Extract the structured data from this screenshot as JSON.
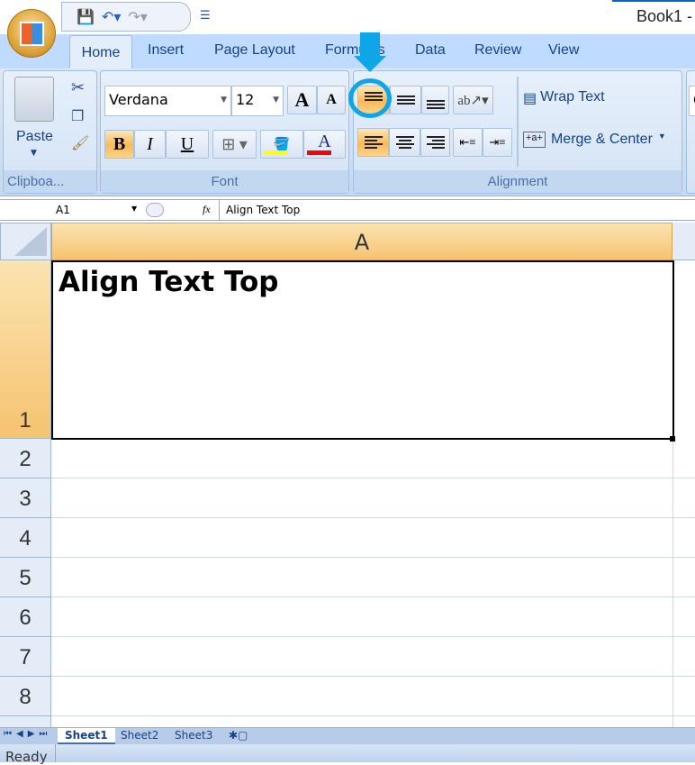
{
  "window": {
    "title": "Book1 -"
  },
  "quick_access": {
    "save_icon": "save-icon",
    "undo_icon": "undo-icon",
    "redo_icon": "redo-icon",
    "customize": "▼"
  },
  "tabs": [
    "Home",
    "Insert",
    "Page Layout",
    "Formulas",
    "Data",
    "Review",
    "View"
  ],
  "ribbon": {
    "clipboard": {
      "label": "Clipboa...",
      "paste": "Paste"
    },
    "font": {
      "label": "Font",
      "font_name": "Verdana",
      "font_size": "12",
      "bold": "B",
      "italic": "I",
      "underline": "U",
      "grow": "A",
      "shrink": "A",
      "font_color": "A",
      "fill_color_hex": "#ffff00",
      "font_color_hex": "#ff0000"
    },
    "alignment": {
      "label": "Alignment",
      "wrap_text": "Wrap Text",
      "merge_center": "Merge & Center",
      "top_align_selected": true,
      "left_align_selected": true
    },
    "next_group_partial": "G"
  },
  "formula_bar": {
    "name_box": "A1",
    "fx": "fx",
    "value": "Align Text Top"
  },
  "sheet": {
    "column": "A",
    "rows": [
      "1",
      "2",
      "3",
      "4",
      "5",
      "6",
      "7",
      "8"
    ],
    "cell_a1": "Align Text Top"
  },
  "sheet_tabs": [
    "Sheet1",
    "Sheet2",
    "Sheet3"
  ],
  "active_sheet": "Sheet1",
  "status": "Ready",
  "annotation": {
    "color": "#0ea5e9"
  }
}
